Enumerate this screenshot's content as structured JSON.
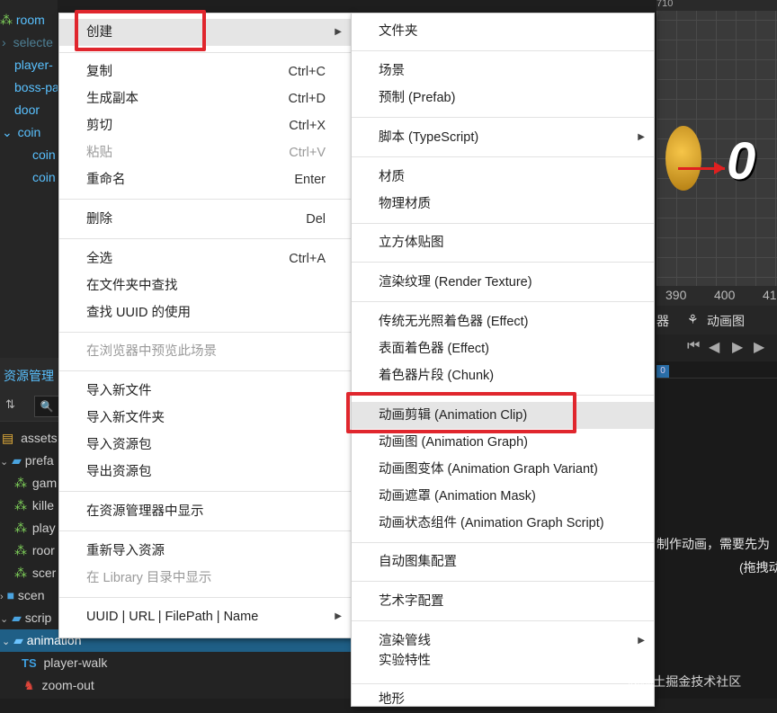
{
  "hierarchy": {
    "items": [
      {
        "label": "room"
      },
      {
        "label": "selecte"
      },
      {
        "label": "player-"
      },
      {
        "label": "boss-pa"
      },
      {
        "label": "door"
      },
      {
        "label": "coin"
      },
      {
        "label": "coin"
      },
      {
        "label": "coin"
      }
    ]
  },
  "assets": {
    "title": "资源管理",
    "search_icon": "search-icon",
    "items": [
      {
        "label": "assets"
      },
      {
        "label": "prefa"
      },
      {
        "label": "gam"
      },
      {
        "label": "kille"
      },
      {
        "label": "play"
      },
      {
        "label": "roor"
      },
      {
        "label": "scer"
      },
      {
        "label": "scen"
      },
      {
        "label": "scrip"
      },
      {
        "label": "animation"
      },
      {
        "label": "player-walk"
      },
      {
        "label": "zoom-out"
      }
    ],
    "ts_badge": "TS"
  },
  "scene": {
    "ruler_top": "710",
    "ruler_bottom": [
      "390",
      "400",
      "41"
    ],
    "digit": "0"
  },
  "animation_panel": {
    "tab_partial": "器",
    "tab_anim_graph": "动画图",
    "timeline_marker": "0",
    "hint_text_1": "制作动画，需要先为",
    "hint_text_2": "(拖拽动"
  },
  "context_menu": {
    "items": {
      "create": "创建",
      "copy": "复制",
      "copy_sc": "Ctrl+C",
      "duplicate": "生成副本",
      "duplicate_sc": "Ctrl+D",
      "cut": "剪切",
      "cut_sc": "Ctrl+X",
      "paste": "粘贴",
      "paste_sc": "Ctrl+V",
      "rename": "重命名",
      "rename_sc": "Enter",
      "delete": "删除",
      "delete_sc": "Del",
      "select_all": "全选",
      "select_all_sc": "Ctrl+A",
      "find_in_folder": "在文件夹中查找",
      "find_uuid": "查找 UUID 的使用",
      "preview_browser": "在浏览器中预览此场景",
      "import_file": "导入新文件",
      "import_folder": "导入新文件夹",
      "import_package": "导入资源包",
      "export_package": "导出资源包",
      "show_in_explorer": "在资源管理器中显示",
      "reimport": "重新导入资源",
      "show_in_library": "在 Library 目录中显示",
      "uuid_url": "UUID | URL | FilePath | Name"
    }
  },
  "create_submenu": {
    "items": {
      "folder": "文件夹",
      "scene": "场景",
      "prefab": "预制 (Prefab)",
      "script": "脚本 (TypeScript)",
      "material": "材质",
      "physics_material": "物理材质",
      "cubemap": "立方体贴图",
      "render_texture": "渲染纹理 (Render Texture)",
      "unlit_effect": "传统无光照着色器 (Effect)",
      "surface_effect": "表面着色器 (Effect)",
      "chunk": "着色器片段 (Chunk)",
      "anim_clip": "动画剪辑 (Animation Clip)",
      "anim_graph": "动画图 (Animation Graph)",
      "anim_graph_variant": "动画图变体 (Animation Graph Variant)",
      "anim_mask": "动画遮罩 (Animation Mask)",
      "anim_graph_script": "动画状态组件 (Animation Graph Script)",
      "auto_atlas": "自动图集配置",
      "label_atlas": "艺术字配置",
      "render_pipeline": "渲染管线",
      "experimental": "实验特性",
      "terrain": "地形"
    }
  },
  "watermark": "@稀土掘金技术社区",
  "colors": {
    "highlight_box": "#e0262d",
    "selection": "#1f5f86",
    "tree_text": "#59c1ff"
  }
}
